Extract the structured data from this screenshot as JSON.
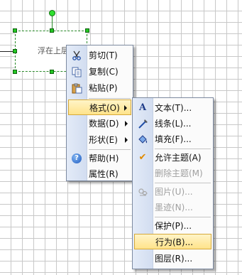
{
  "canvas": {
    "shape_label": "浮在上层"
  },
  "context_menu": {
    "items": [
      {
        "label": "剪切(T)",
        "icon": "scissors-icon",
        "has_submenu": false,
        "enabled": true
      },
      {
        "label": "复制(C)",
        "icon": "copy-icon",
        "has_submenu": false,
        "enabled": true
      },
      {
        "label": "粘贴(P)",
        "icon": "paste-icon",
        "has_submenu": false,
        "enabled": true
      },
      {
        "label": "格式(O)",
        "has_submenu": true,
        "enabled": true,
        "highlighted": true
      },
      {
        "label": "数据(D)",
        "has_submenu": true,
        "enabled": true
      },
      {
        "label": "形状(E)",
        "has_submenu": true,
        "enabled": true
      },
      {
        "label": "帮助(H)",
        "icon": "help-icon",
        "has_submenu": false,
        "enabled": true
      },
      {
        "label": "属性(R)",
        "has_submenu": false,
        "enabled": true
      }
    ]
  },
  "format_submenu": {
    "items": [
      {
        "label": "文本(T)...",
        "icon": "text-format-icon",
        "enabled": true
      },
      {
        "label": "线条(L)...",
        "icon": "line-format-icon",
        "enabled": true
      },
      {
        "label": "填充(F)...",
        "icon": "fill-format-icon",
        "enabled": true
      },
      {
        "label": "允许主题(A)",
        "icon": "check-icon",
        "enabled": true,
        "checked": true
      },
      {
        "label": "删除主题(M)",
        "enabled": false
      },
      {
        "label": "图片(U)...",
        "icon": "picture-icon",
        "enabled": false
      },
      {
        "label": "墨迹(N)...",
        "enabled": false
      },
      {
        "label": "保护(P)...",
        "enabled": true
      },
      {
        "label": "行为(B)...",
        "enabled": true,
        "highlighted": true
      },
      {
        "label": "图层(R)...",
        "enabled": true
      }
    ]
  },
  "colors": {
    "selection_handle": "#23c623",
    "highlight": "#ffe38a",
    "menu_gutter": "#d2ddf0",
    "disabled_text": "#a0a0a0"
  }
}
